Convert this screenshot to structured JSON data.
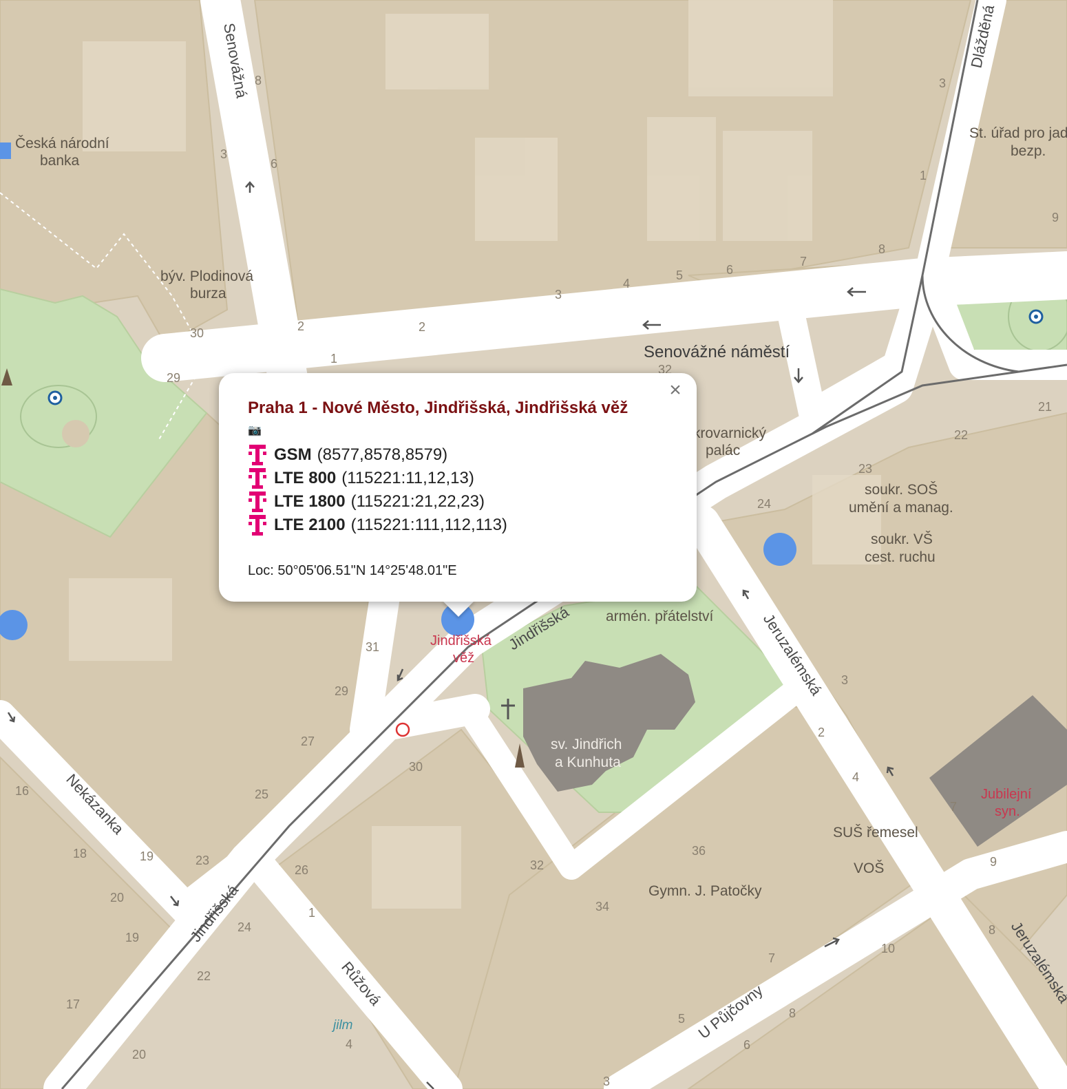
{
  "map": {
    "streets": {
      "senovazna": "Senovážná",
      "dlazdena": "Dlážděná",
      "senovazne_namesti": "Senovážné náměstí",
      "jindrisska_1": "Jindřišská",
      "jindrisska_2": "Jindřišská",
      "jeruzalemska_1": "Jeruzalémská",
      "jeruzalemska_2": "Jeruzalémská",
      "nekazanka": "Nekázanka",
      "ruzova": "Růžová",
      "u_pujcovny": "U Půjčovny"
    },
    "places": {
      "cnb_1": "Česká národní",
      "cnb_2": "banka",
      "plodinova_1": "býv. Plodinová",
      "plodinova_2": "burza",
      "st_urad_1": "St. úřad pro jad",
      "st_urad_2": "bezp.",
      "cukrovarnicky_1": "Cukrovarnický",
      "cukrovarnicky_2": "palác",
      "sos_1": "soukr. SOŠ",
      "sos_2": "umění a manag.",
      "vs_1": "soukr. VŠ",
      "vs_2": "cest. ruchu",
      "armen": "armén. přátelství",
      "vez_1": "Jindřišská",
      "vez_2": "věž",
      "kostel_1": "sv. Jindřich",
      "kostel_2": "a Kunhuta",
      "syn_1": "Jubilejní",
      "syn_2": "syn.",
      "sus": "SUŠ řemesel",
      "vos": "VOŠ",
      "gymn": "Gymn. J. Patočky",
      "jilm": "jilm"
    },
    "house_numbers": {
      "n8a": "8",
      "n3a": "3",
      "n6a": "6",
      "n30a": "30",
      "n29a": "29",
      "n2a": "2",
      "n2b": "2",
      "n1a": "1",
      "n3b": "3",
      "n4a": "4",
      "n5a": "5",
      "n6b": "6",
      "n7a": "7",
      "n8b": "8",
      "n3c": "3",
      "n1b": "1",
      "n9a": "9",
      "n32a": "32",
      "n21a": "21",
      "n22a": "22",
      "n23a": "23",
      "n24a": "24",
      "n31a": "31",
      "n29b": "29",
      "n27a": "27",
      "n30b": "30",
      "n25a": "25",
      "n16a": "16",
      "n18a": "18",
      "n19a": "19",
      "n23b": "23",
      "n20a": "20",
      "n19b": "19",
      "n24b": "24",
      "n26a": "26",
      "n1c": "1",
      "n22b": "22",
      "n17a": "17",
      "n20b": "20",
      "n4b": "4",
      "n32b": "32",
      "n36a": "36",
      "n34a": "34",
      "n3d": "3",
      "n2c": "2",
      "n4c": "4",
      "n7b": "7",
      "n9b": "9",
      "n8c": "8",
      "n10a": "10",
      "n7c": "7",
      "n8d": "8",
      "n5b": "5",
      "n6c": "6",
      "n3e": "3"
    }
  },
  "popup": {
    "title": "Praha 1 - Nové Město, Jindřišská, Jindřišská věž",
    "camera_icon": "📷",
    "close_label": "×",
    "techs": [
      {
        "name": "GSM",
        "ids": "(8577,8578,8579)"
      },
      {
        "name": "LTE 800",
        "ids": "(115221:11,12,13)"
      },
      {
        "name": "LTE 1800",
        "ids": "(115221:21,22,23)"
      },
      {
        "name": "LTE 2100",
        "ids": "(115221:111,112,113)"
      }
    ],
    "loc": "Loc: 50°05'06.51\"N 14°25'48.01\"E"
  },
  "colors": {
    "building": "#d9cdb6",
    "road": "#ffffff",
    "park": "#c8dfb4",
    "church": "#8f8a84",
    "marker": "#5b94e6",
    "popup_title": "#7b1113",
    "operator": "#e20074"
  }
}
